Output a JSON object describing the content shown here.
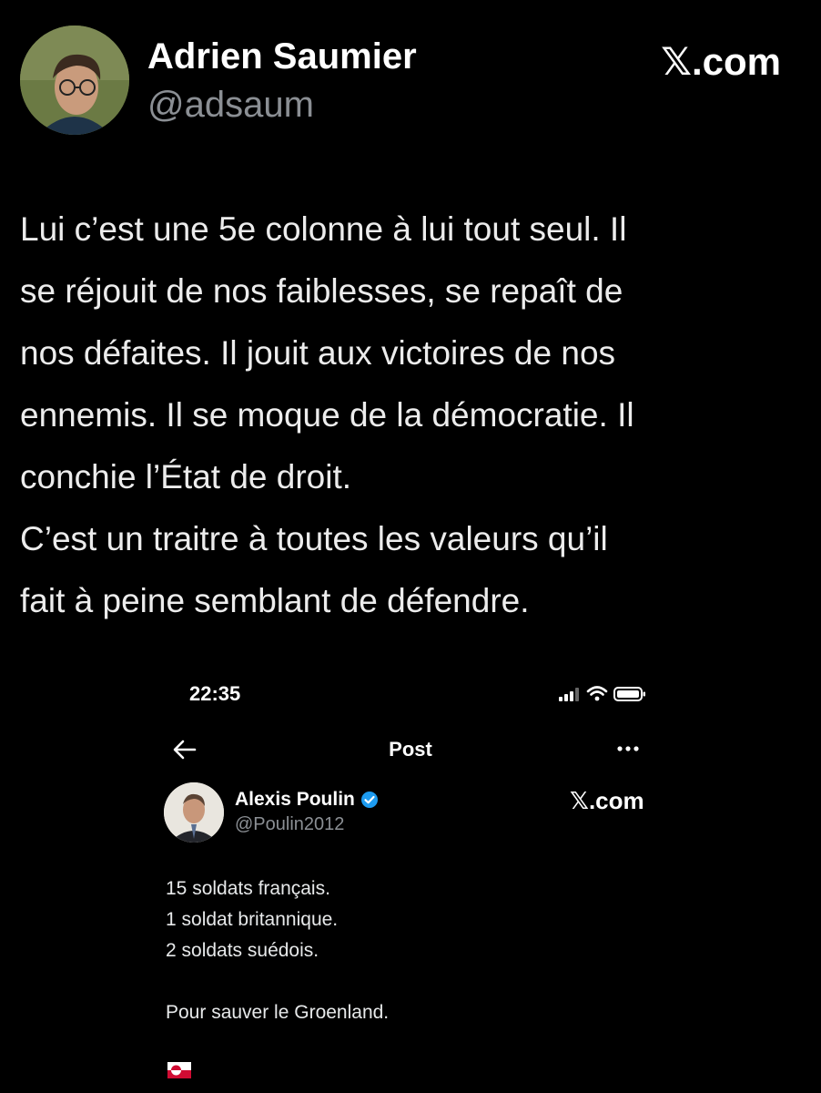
{
  "author": {
    "name": "Adrien Saumier",
    "handle": "@adsaum",
    "avatar_icon": "profile-photo"
  },
  "brand": "𝕏.com",
  "tweet": {
    "lines": [
      "Lui c’est une 5e colonne à lui tout seul. Il",
      "se réjouit de nos faiblesses, se repaît de",
      "nos défaites. Il jouit aux victoires de nos",
      "ennemis. Il se moque de la démocratie. Il",
      "conchie l’État de droit.",
      "C’est un traitre à toutes les valeurs qu’il",
      "fait à peine semblant de défendre."
    ]
  },
  "embedded_screenshot": {
    "status_bar": {
      "time": "22:35",
      "icons": [
        "signal-icon",
        "wifi-icon",
        "battery-icon"
      ]
    },
    "nav": {
      "title": "Post",
      "back_icon": "back-arrow-icon",
      "more_icon": "more-dots-icon"
    },
    "quoted_post": {
      "name": "Alexis Poulin",
      "handle": "@Poulin2012",
      "verified": true,
      "brand": "𝕏.com",
      "lines": [
        "15 soldats français.",
        "1 soldat britannique.",
        "2 soldats suédois.",
        "",
        "Pour sauver le Groenland.",
        ""
      ],
      "flag_icon": "greenland-flag-icon"
    }
  },
  "colors": {
    "background": "#000000",
    "text": "#ececec",
    "secondary_text": "#8b8f94",
    "verified_blue": "#1d9bf0",
    "flag_red": "#d00c33"
  }
}
